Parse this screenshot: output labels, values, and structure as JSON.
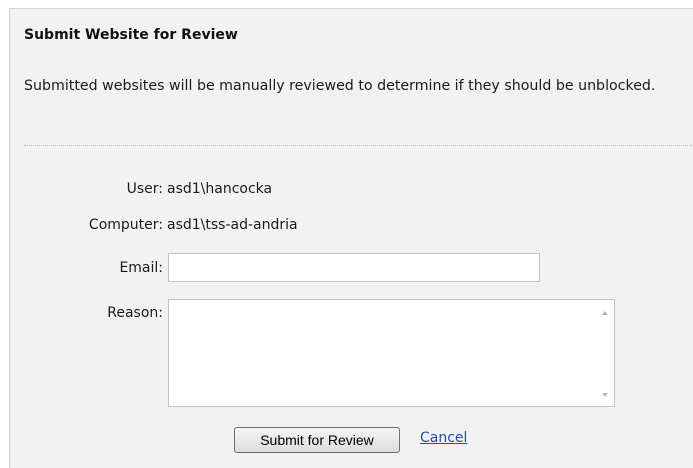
{
  "dialog": {
    "title": "Submit Website for Review",
    "description": "Submitted websites will be manually reviewed to determine if they should be unblocked."
  },
  "fields": {
    "user_label": "User:",
    "user_value": "asd1\\hancocka",
    "computer_label": "Computer:",
    "computer_value": "asd1\\tss-ad-andria",
    "email_label": "Email:",
    "email_value": "",
    "reason_label": "Reason:",
    "reason_value": ""
  },
  "actions": {
    "submit_label": "Submit for Review",
    "cancel_label": "Cancel"
  },
  "colors": {
    "panel_background": "#f2f2f2",
    "link": "#1f4fa8"
  }
}
